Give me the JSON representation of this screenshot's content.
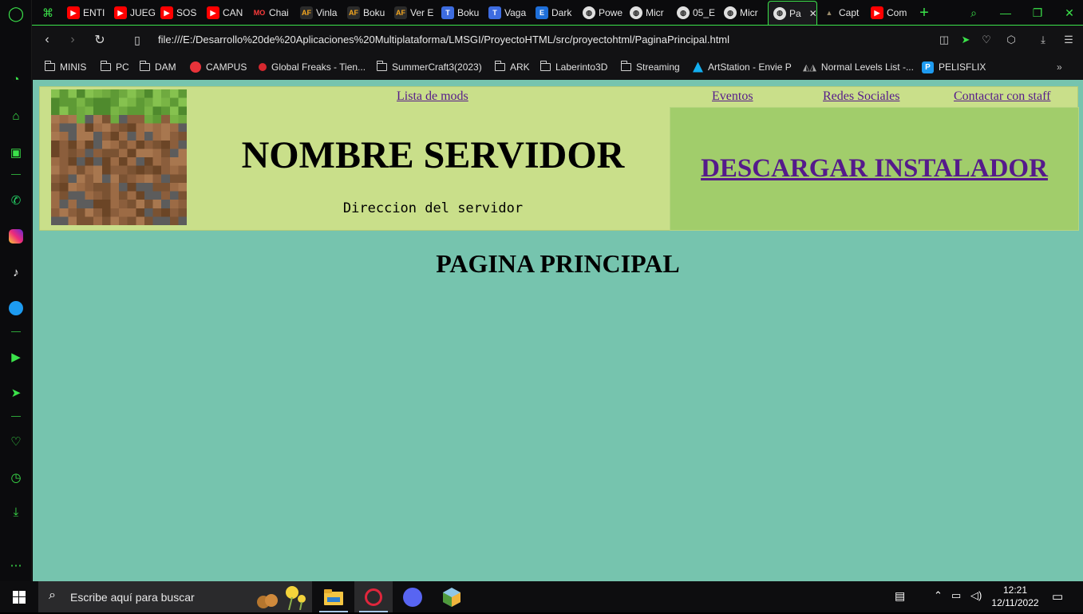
{
  "browser": {
    "tabs": [
      {
        "label": "ENTI",
        "icon": "youtube-icon"
      },
      {
        "label": "JUEG",
        "icon": "youtube-icon"
      },
      {
        "label": "SOS",
        "icon": "youtube-icon"
      },
      {
        "label": "CAN",
        "icon": "youtube-icon"
      },
      {
        "label": "Chai",
        "icon": "mo-icon"
      },
      {
        "label": "Vinla",
        "icon": "af-icon"
      },
      {
        "label": "Boku",
        "icon": "af-icon"
      },
      {
        "label": "Ver E",
        "icon": "af-icon"
      },
      {
        "label": "Boku",
        "icon": "tmo-icon"
      },
      {
        "label": "Vaga",
        "icon": "tmo-icon"
      },
      {
        "label": "Dark",
        "icon": "e-icon"
      },
      {
        "label": "Powe",
        "icon": "globe-icon"
      },
      {
        "label": "Micr",
        "icon": "globe-icon"
      },
      {
        "label": "05_E",
        "icon": "globe-icon"
      },
      {
        "label": "Micr",
        "icon": "globe-icon"
      },
      {
        "label": "Pa",
        "icon": "globe-icon",
        "active": true
      },
      {
        "label": "Capt",
        "icon": "hat-icon"
      },
      {
        "label": "Com",
        "icon": "youtube-icon"
      }
    ],
    "url": "file:///E:/Desarrollo%20de%20Aplicaciones%20Multiplataforma/LMSGI/ProyectoHTML/src/proyectohtml/PaginaPrincipal.html",
    "bookmarks": [
      {
        "label": "MINIS",
        "icon": "folder-icon"
      },
      {
        "label": "PC",
        "icon": "folder-icon"
      },
      {
        "label": "DAM",
        "icon": "folder-icon"
      },
      {
        "label": "CAMPUS",
        "icon": "campus-icon"
      },
      {
        "label": "Global Freaks - Tien...",
        "icon": "globalfreaks-icon"
      },
      {
        "label": "SummerCraft3(2023)",
        "icon": "folder-icon"
      },
      {
        "label": "ARK",
        "icon": "folder-icon"
      },
      {
        "label": "Laberinto3D",
        "icon": "folder-icon"
      },
      {
        "label": "Streaming",
        "icon": "folder-icon"
      },
      {
        "label": "ArtStation - Envie P",
        "icon": "artstation-icon"
      },
      {
        "label": "Normal Levels List -...",
        "icon": "levels-icon"
      },
      {
        "label": "PELISFLIX",
        "icon": "pelisflix-icon"
      }
    ],
    "accent_color": "#3be34a"
  },
  "page": {
    "server_name": "NOMBRE SERVIDOR",
    "server_address": "Direccion del servidor",
    "nav": {
      "mods": "Lista de mods",
      "events": "Eventos",
      "social": "Redes Sociales",
      "staff": "Contactar con staff"
    },
    "download_label": "DESCARGAR INSTALADOR",
    "heading": "PAGINA PRINCIPAL",
    "colors": {
      "background": "#76c4ae",
      "header": "#c9df8a",
      "download_box": "#a1cd6b",
      "link": "#551a8b"
    }
  },
  "taskbar": {
    "search_placeholder": "Escribe aquí para buscar",
    "time": "12:21",
    "date": "12/11/2022"
  }
}
